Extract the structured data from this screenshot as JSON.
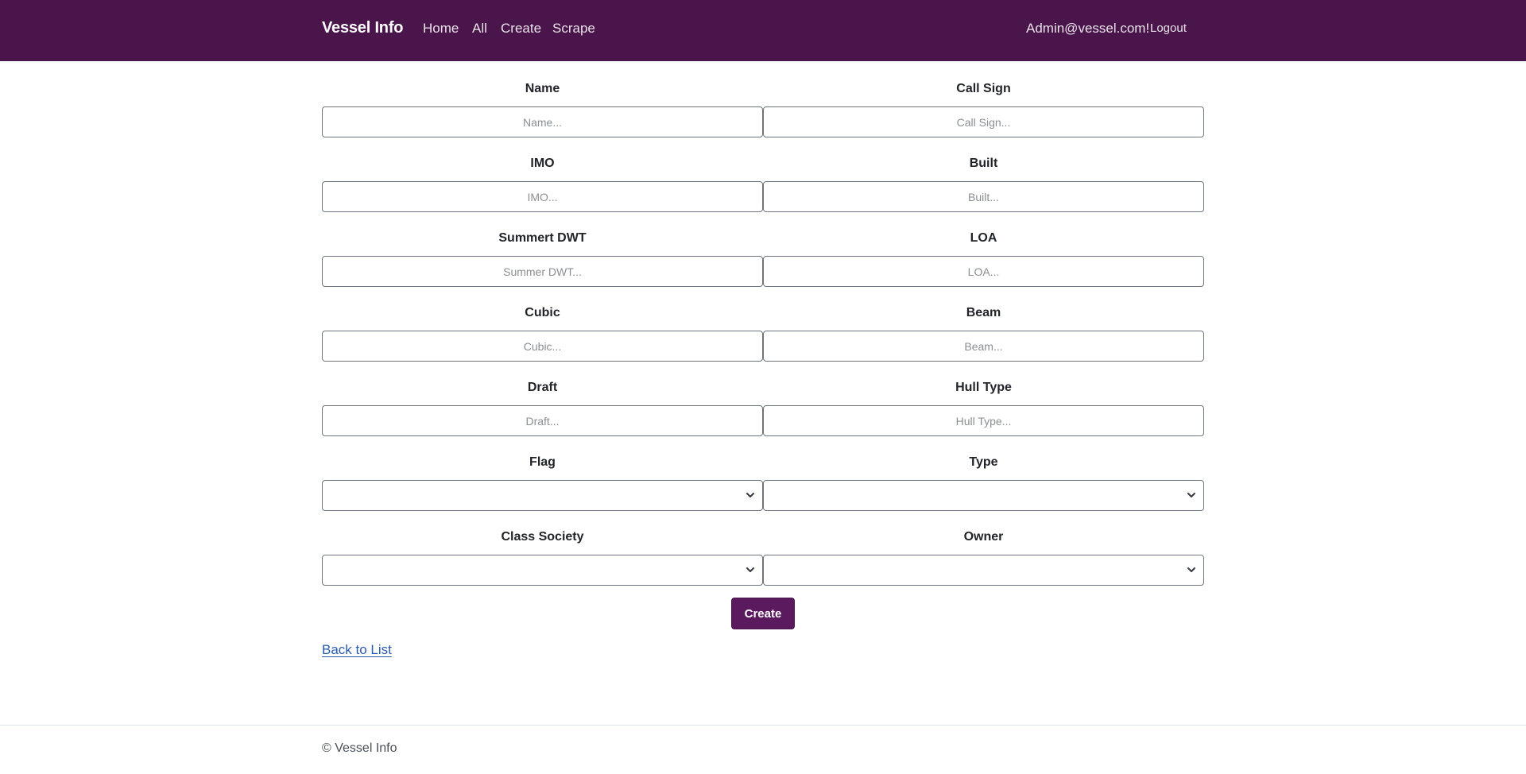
{
  "navbar": {
    "brand": "Vessel Info",
    "links": [
      "Home",
      "All",
      "Create",
      "Scrape"
    ],
    "user": "Admin@vessel.com!",
    "logout": "Logout",
    "background": "#4a154b"
  },
  "form": {
    "name": {
      "label": "Name",
      "placeholder": "Name..."
    },
    "call_sign": {
      "label": "Call Sign",
      "placeholder": "Call Sign..."
    },
    "imo": {
      "label": "IMO",
      "placeholder": "IMO..."
    },
    "built": {
      "label": "Built",
      "placeholder": "Built..."
    },
    "summer_dwt": {
      "label": "Summert DWT",
      "placeholder": "Summer DWT..."
    },
    "loa": {
      "label": "LOA",
      "placeholder": "LOA..."
    },
    "cubic": {
      "label": "Cubic",
      "placeholder": "Cubic..."
    },
    "beam": {
      "label": "Beam",
      "placeholder": "Beam..."
    },
    "draft": {
      "label": "Draft",
      "placeholder": "Draft..."
    },
    "hull_type": {
      "label": "Hull Type",
      "placeholder": "Hull Type..."
    },
    "flag": {
      "label": "Flag",
      "selected": ""
    },
    "type": {
      "label": "Type",
      "selected": ""
    },
    "class_society": {
      "label": "Class Society",
      "selected": ""
    },
    "owner": {
      "label": "Owner",
      "selected": ""
    },
    "submit_label": "Create",
    "button_color": "#5b1a5e"
  },
  "back_link": "Back to List",
  "footer": {
    "text": "© Vessel Info"
  }
}
